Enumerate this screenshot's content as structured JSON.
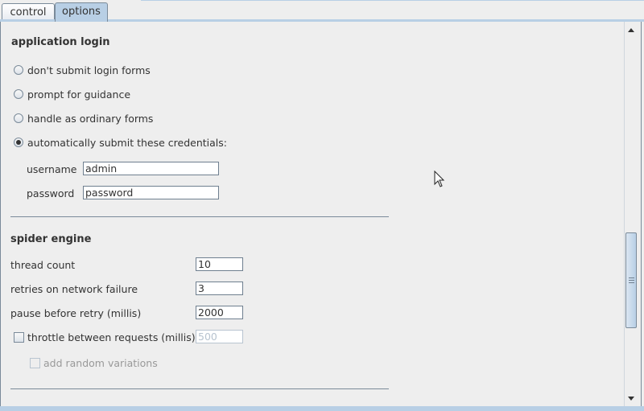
{
  "tabs": [
    {
      "label": "control",
      "selected": false
    },
    {
      "label": "options",
      "selected": true
    }
  ],
  "login": {
    "title": "application login",
    "options": [
      {
        "label": "don't submit login forms",
        "selected": false
      },
      {
        "label": "prompt for guidance",
        "selected": false
      },
      {
        "label": "handle as ordinary forms",
        "selected": false
      },
      {
        "label": "automatically submit these credentials:",
        "selected": true
      }
    ],
    "username_label": "username",
    "username_value": "admin",
    "password_label": "password",
    "password_value": "password"
  },
  "engine": {
    "title": "spider engine",
    "thread_count_label": "thread count",
    "thread_count_value": "10",
    "retries_label": "retries on network failure",
    "retries_value": "3",
    "pause_label": "pause before retry (millis)",
    "pause_value": "2000",
    "throttle_label": "throttle between requests (millis)",
    "throttle_value": "500",
    "throttle_checked": false,
    "random_label": "add random variations",
    "random_checked": false
  },
  "colors": {
    "accent": "#b8cfe5",
    "border": "#7a8a99",
    "background": "#eeeeee"
  },
  "icons": {
    "scroll_up": "arrow-up-icon",
    "scroll_down": "arrow-down-icon",
    "cursor": "mouse-pointer-icon"
  }
}
